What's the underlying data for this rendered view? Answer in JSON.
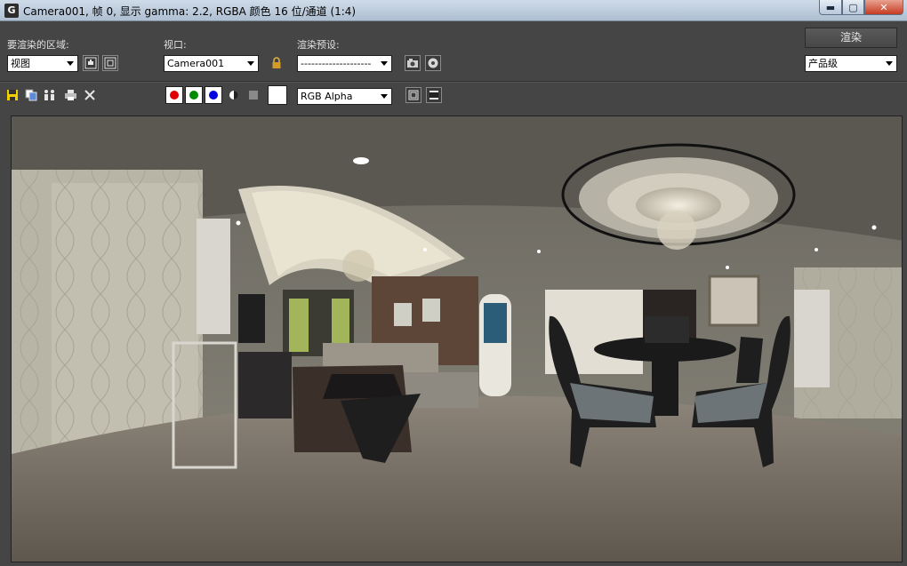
{
  "window": {
    "icon_glyph": "G",
    "title": "Camera001, 帧 0, 显示 gamma: 2.2, RGBA 颜色 16 位/通道 (1:4)",
    "min_glyph": "▬",
    "max_glyph": "▢",
    "close_glyph": "✕"
  },
  "toolbar": {
    "area_label": "要渲染的区域:",
    "area_value": "视图",
    "viewport_label": "视口:",
    "viewport_value": "Camera001",
    "preset_label": "渲染预设:",
    "preset_value": "--------------------",
    "render_button": "渲染",
    "quality_value": "产品级"
  },
  "channels": {
    "red": "#e00000",
    "green": "#008a00",
    "blue": "#0000e0",
    "display_value": "RGB Alpha"
  },
  "icons": [
    "save-icon",
    "copy-icon",
    "clone-icon",
    "print-icon",
    "clear-icon",
    "edit-region-icon",
    "auto-region-icon",
    "lock-icon",
    "env-icon",
    "settings-icon",
    "alpha-icon",
    "mono-icon",
    "swatch",
    "frame-icon"
  ]
}
